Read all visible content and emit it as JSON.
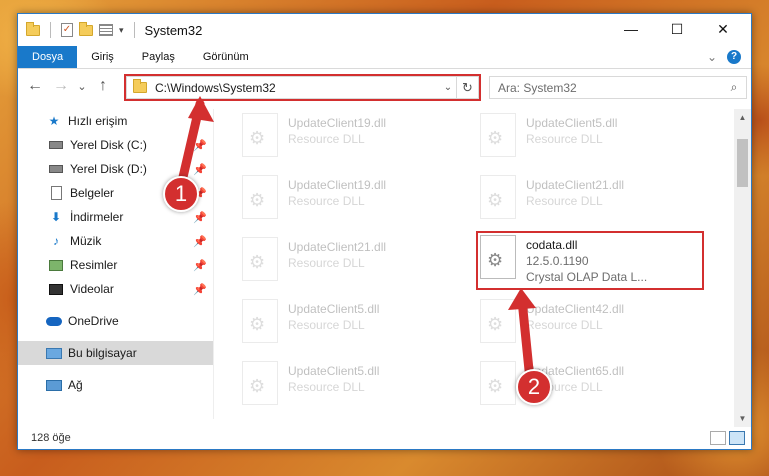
{
  "window": {
    "title": "System32",
    "minimize": "—",
    "maximize": "☐",
    "close": "✕"
  },
  "ribbon": {
    "tabs": [
      "Dosya",
      "Giriş",
      "Paylaş",
      "Görünüm"
    ],
    "help": "?",
    "collapse": "⌄"
  },
  "address": {
    "path": "C:\\Windows\\System32",
    "dropdown": "⌄",
    "refresh": "↻"
  },
  "search": {
    "placeholder": "Ara: System32",
    "icon": "search-icon"
  },
  "nav": {
    "back": "←",
    "forward": "→",
    "recent": "⌄",
    "up": "↑"
  },
  "sidebar": {
    "items": [
      {
        "label": "Hızlı erişim",
        "icon": "star-icon"
      },
      {
        "label": "Yerel Disk (C:)",
        "icon": "drive-icon",
        "pinned": true
      },
      {
        "label": "Yerel Disk (D:)",
        "icon": "drive-icon",
        "pinned": true
      },
      {
        "label": "Belgeler",
        "icon": "documents-icon",
        "pinned": true
      },
      {
        "label": "İndirmeler",
        "icon": "downloads-icon",
        "pinned": true
      },
      {
        "label": "Müzik",
        "icon": "music-icon",
        "pinned": true
      },
      {
        "label": "Resimler",
        "icon": "pictures-icon",
        "pinned": true
      },
      {
        "label": "Videolar",
        "icon": "videos-icon",
        "pinned": true
      },
      {
        "label": "OneDrive",
        "icon": "onedrive-icon"
      },
      {
        "label": "Bu bilgisayar",
        "icon": "computer-icon",
        "selected": true
      },
      {
        "label": "Ağ",
        "icon": "network-icon"
      }
    ]
  },
  "files": [
    {
      "name": "UpdateClient19.dll",
      "meta": "Resource DLL"
    },
    {
      "name": "UpdateClient5.dll",
      "meta": "Resource DLL"
    },
    {
      "name": "UpdateClient19.dll",
      "meta": "Resource DLL"
    },
    {
      "name": "UpdateClient21.dll",
      "meta": "Resource DLL"
    },
    {
      "name": "UpdateClient21.dll",
      "meta": "Resource DLL"
    },
    {
      "name": "codata.dll",
      "version": "12.5.0.1190",
      "meta": "Crystal OLAP Data L...",
      "highlighted": true
    },
    {
      "name": "UpdateClient5.dll",
      "meta": "Resource DLL"
    },
    {
      "name": "UpdateClient42.dll",
      "meta": "Resource DLL"
    },
    {
      "name": "UpdateClient5.dll",
      "meta": "Resource DLL"
    },
    {
      "name": "UpdateClient65.dll",
      "meta": "Resource DLL"
    }
  ],
  "status": {
    "count": "128 öğe"
  },
  "callouts": [
    "1",
    "2"
  ],
  "colors": {
    "accent": "#1979ca",
    "callout": "#d32f2f"
  }
}
